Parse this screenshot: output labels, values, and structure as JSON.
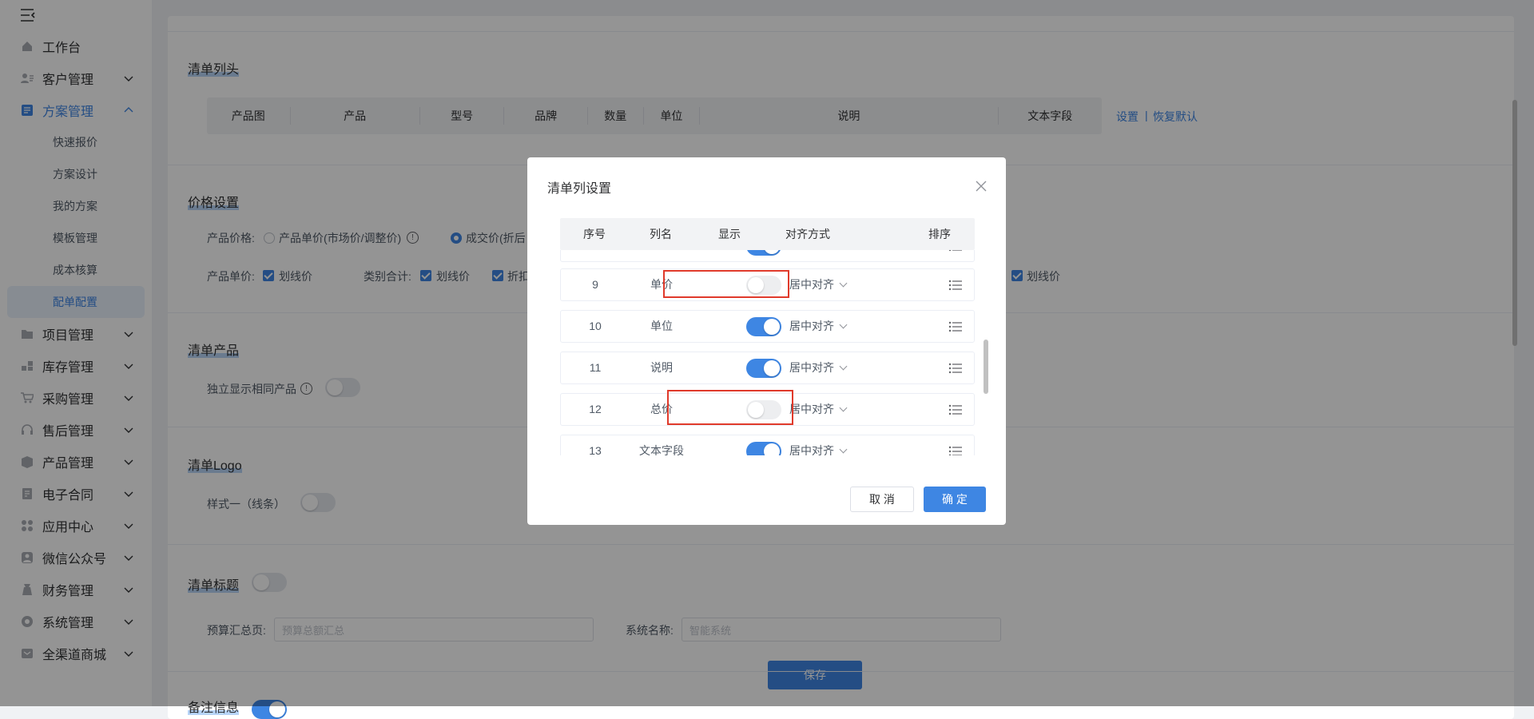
{
  "sidebar": {
    "items": [
      {
        "label": "工作台",
        "icon": "home-icon"
      },
      {
        "label": "客户管理",
        "icon": "customer-icon"
      },
      {
        "label": "方案管理",
        "icon": "scheme-icon"
      },
      {
        "label": "项目管理",
        "icon": "folder-icon"
      },
      {
        "label": "库存管理",
        "icon": "inventory-icon"
      },
      {
        "label": "采购管理",
        "icon": "cart-icon"
      },
      {
        "label": "售后管理",
        "icon": "headset-icon"
      },
      {
        "label": "产品管理",
        "icon": "product-icon"
      },
      {
        "label": "电子合同",
        "icon": "contract-icon"
      },
      {
        "label": "应用中心",
        "icon": "apps-icon"
      },
      {
        "label": "微信公众号",
        "icon": "wechat-icon"
      },
      {
        "label": "财务管理",
        "icon": "finance-icon"
      },
      {
        "label": "系统管理",
        "icon": "system-icon"
      },
      {
        "label": "全渠道商城",
        "icon": "mall-icon"
      }
    ],
    "subitems": [
      "快速报价",
      "方案设计",
      "我的方案",
      "模板管理",
      "成本核算",
      "配单配置"
    ]
  },
  "main": {
    "header_section": {
      "title": "清单列头",
      "columns": [
        "产品图",
        "产品",
        "型号",
        "品牌",
        "数量",
        "单位",
        "说明",
        "文本字段"
      ],
      "link_settings": "设置",
      "link_sep": "|",
      "link_restore": "恢复默认"
    },
    "price_section": {
      "title": "价格设置",
      "product_price_label": "产品价格:",
      "opt_unit_price": "产品单价(市场价/调整价)",
      "opt_deal_price": "成交价(折后",
      "unit_price_label": "产品单价:",
      "strike_price": "划线价",
      "category_total_label": "类别合计:",
      "discount": "折扣",
      "strike_price_right": "划线价"
    },
    "product_section": {
      "title": "清单产品",
      "same_product_label": "独立显示相同产品"
    },
    "logo_section": {
      "title": "清单Logo",
      "style_label": "样式一（线条）"
    },
    "title_section": {
      "title": "清单标题",
      "budget_label": "预算汇总页:",
      "budget_placeholder": "预算总额汇总",
      "system_label": "系统名称:",
      "system_placeholder": "智能系统"
    },
    "save": "保存",
    "remark_title": "备注信息"
  },
  "modal": {
    "title": "清单列设置",
    "headers": [
      "序号",
      "列名",
      "显示",
      "对齐方式",
      "排序"
    ],
    "rows": [
      {
        "index": "9",
        "name": "单价",
        "show": false,
        "align": "居中对齐"
      },
      {
        "index": "10",
        "name": "单位",
        "show": true,
        "align": "居中对齐"
      },
      {
        "index": "11",
        "name": "说明",
        "show": true,
        "align": "居中对齐"
      },
      {
        "index": "12",
        "name": "总价",
        "show": false,
        "align": "居中对齐"
      },
      {
        "index": "13",
        "name": "文本字段",
        "show": true,
        "align": "居中对齐"
      }
    ],
    "cancel": "取 消",
    "confirm": "确 定"
  },
  "colors": {
    "accent": "#3e86e3",
    "highlight": "#e03a2b"
  }
}
